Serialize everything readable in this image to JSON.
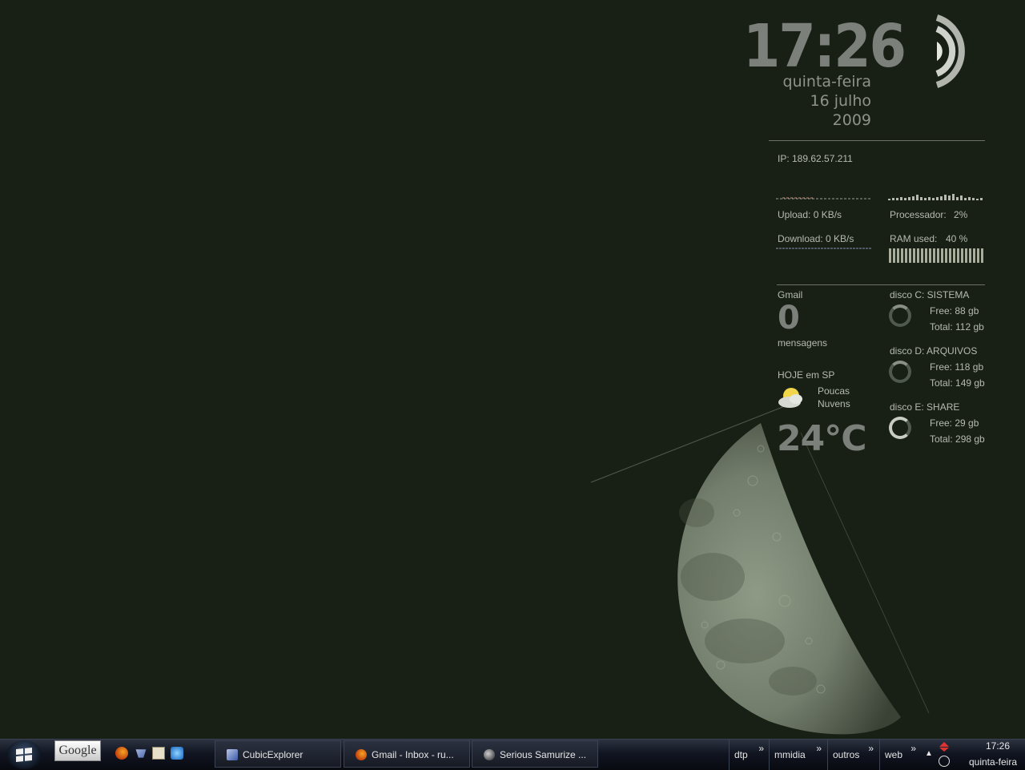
{
  "clock": {
    "time": "17:26",
    "weekday": "quinta-feira",
    "date": "16 julho",
    "year": "2009"
  },
  "network": {
    "ip": "IP: 189.62.57.211",
    "upload": "Upload: 0 KB/s",
    "download": "Download: 0 KB/s"
  },
  "system": {
    "cpu_label": "Processador:",
    "cpu_value": "2%",
    "ram_label": "RAM used:",
    "ram_value": "40 %"
  },
  "gmail": {
    "label": "Gmail",
    "count": "0",
    "unit": "mensagens"
  },
  "weather": {
    "label": "HOJE em SP",
    "condition_line1": "Poucas",
    "condition_line2": "Nuvens",
    "temperature": "24°C"
  },
  "disks": [
    {
      "label": "disco C: SISTEMA",
      "free": "Free: 88 gb",
      "total": "Total: 112 gb",
      "used_fraction": 0.21
    },
    {
      "label": "disco D: ARQUIVOS",
      "free": "Free: 118 gb",
      "total": "Total: 149 gb",
      "used_fraction": 0.21
    },
    {
      "label": "disco E: SHARE",
      "free": "Free: 29 gb",
      "total": "Total: 298 gb",
      "used_fraction": 0.9
    }
  ],
  "taskbar": {
    "google_label": "Google",
    "windows": [
      {
        "label": "CubicExplorer"
      },
      {
        "label": "Gmail - Inbox - ru..."
      },
      {
        "label": "Serious Samurize ..."
      }
    ],
    "toolbars": [
      "dtp",
      "mmidia",
      "outros",
      "web"
    ],
    "chevron": "»",
    "tray_time": "17:26",
    "tray_day": "quinta-feira"
  },
  "colors": {
    "desktop_bg": "#182015",
    "widget_text": "#b6baae",
    "big_text": "#7c807a"
  }
}
